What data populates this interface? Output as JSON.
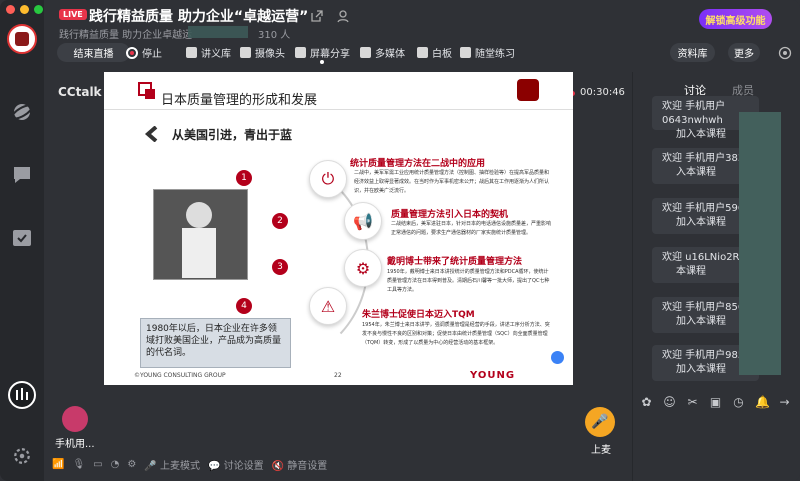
{
  "window": {
    "live_badge": "LIVE",
    "title": "践行精益质量 助力企业“卓越运营”",
    "subtitle": "践行精益质量 助力企业卓越运",
    "viewers": "310 人",
    "promo": "解锁高级功能"
  },
  "toolbar": {
    "end_live": "结束直播",
    "stop": "停止",
    "items": [
      "讲义库",
      "摄像头",
      "屏幕分享",
      "多媒体",
      "白板",
      "随堂练习"
    ],
    "library": "资料库",
    "more": "更多"
  },
  "stage": {
    "brand": "CCtalk",
    "timer": "00:30:46"
  },
  "slide": {
    "title": "日本质量管理的形成和发展",
    "subtitle": "从美国引进，青出于蓝",
    "points": [
      {
        "num": "1",
        "heading": "统计质量管理方法在二战中的应用",
        "body": "二战中，美军军需工业应用统计质量管理方法（控制图、抽样检验等）在提高军品质量和经济效益上取得显著成效。在当时作为军事机密未公开；战后其在工作用逐渐为人们所认识，并在欧美广泛流行。"
      },
      {
        "num": "2",
        "heading": "质量管理方法引入日本的契机",
        "body": "二战结束后，美军进驻日本，针对日本的电话通信设施质量差，严重影响正常通信的问题，要求生产通信器材的厂家实施统计质量管理。"
      },
      {
        "num": "3",
        "heading": "戴明博士带来了统计质量管理方法",
        "body": "1950年，戴明博士来日本讲授统计的质量管理方法和PDCA循环，使统计质量管理方法在日本得到普及。清期后石川馨等一批大师，提出了QC七种工具等方法。"
      },
      {
        "num": "4",
        "heading": "朱兰博士促使日本迈入TQM",
        "body": "1954年，朱兰博士来日本讲学，强调质量管理是经营的手段，讲述工序分析方法、突发不良与慢性不良的区别和对策；促使日本由统计质量管理（SQC）向全面质量管理（TQM）转变，形成了以质量为中心的经营活动的基本框架。"
      }
    ],
    "quote": "1980年以后，日本企业在许多领域打败美国企业，产品成为高质量的代名词。",
    "footer": "©YOUNG CONSULTING GROUP",
    "page": "22",
    "brand": "YOUNG"
  },
  "panel": {
    "tab_discuss": "讨论",
    "tab_members": "成员",
    "messages": [
      {
        "l1": "欢迎 手机用户0643nwhwh",
        "l2": "加入本课程"
      },
      {
        "l1": "欢迎 手机用户3837",
        "l2": "入本课程"
      },
      {
        "l1": "欢迎 手机用户596",
        "l2": "加入本课程"
      },
      {
        "l1": "欢迎 u16LNio2Ro",
        "l2": "本课程"
      },
      {
        "l1": "欢迎 手机用户856",
        "l2": "加入本课程"
      },
      {
        "l1": "欢迎 手机用户985",
        "l2": "加入本课程"
      }
    ]
  },
  "bottom": {
    "user": "手机用...",
    "mic": "上麦",
    "mic_mode": "上麦模式",
    "discuss_settings": "讨论设置",
    "mute_settings": "静音设置"
  }
}
